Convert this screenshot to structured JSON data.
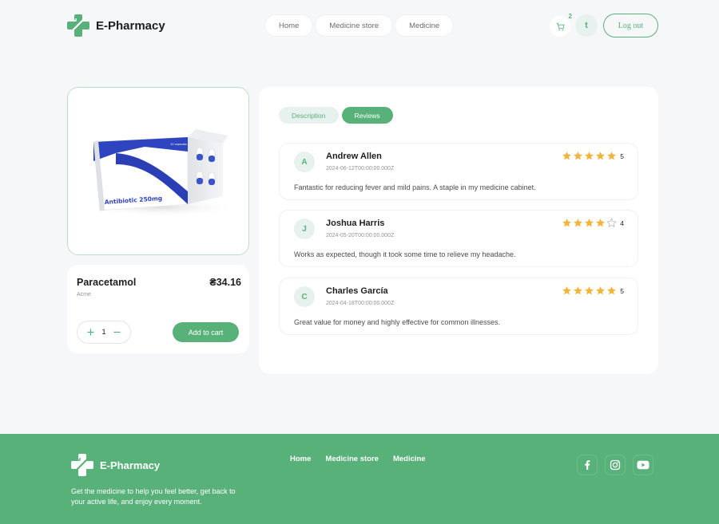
{
  "header": {
    "brand": "E-Pharmacy",
    "nav": [
      "Home",
      "Medicine store",
      "Medicine"
    ],
    "cart_count": "2",
    "user_initial": "t",
    "logout_label": "Log out"
  },
  "product": {
    "name": "Paracetamol",
    "price": "₴34.16",
    "brand": "Acme",
    "quantity": "1",
    "add_to_cart_label": "Add to cart",
    "image_box_text": "Antibiotic 250mg",
    "image_box_small": "10 capsules"
  },
  "tabs": [
    "Description",
    "Reviews"
  ],
  "reviews": [
    {
      "initial": "A",
      "name": "Andrew Allen",
      "date": "2024-06-12T00:00:00.000Z",
      "rating": 5,
      "score": "5",
      "text": "Fantastic for reducing fever and mild pains. A staple in my medicine cabinet."
    },
    {
      "initial": "J",
      "name": "Joshua Harris",
      "date": "2024-05-20T00:00:00.000Z",
      "rating": 4,
      "score": "4",
      "text": "Works as expected, though it took some time to relieve my headache."
    },
    {
      "initial": "C",
      "name": "Charles García",
      "date": "2024-04-18T00:00:00.000Z",
      "rating": 5,
      "score": "5",
      "text": "Great value for money and highly effective for common illnesses."
    }
  ],
  "footer": {
    "brand": "E-Pharmacy",
    "tagline": "Get the medicine to help you feel better, get back to your active life, and enjoy every moment.",
    "nav": [
      "Home",
      "Medicine store",
      "Medicine"
    ],
    "social_icons": [
      "facebook-icon",
      "instagram-icon",
      "youtube-icon"
    ]
  },
  "colors": {
    "accent": "#59b17a",
    "accent_light": "#e7f1ed",
    "star": "#f1b43d",
    "background": "#f6f7f9"
  }
}
